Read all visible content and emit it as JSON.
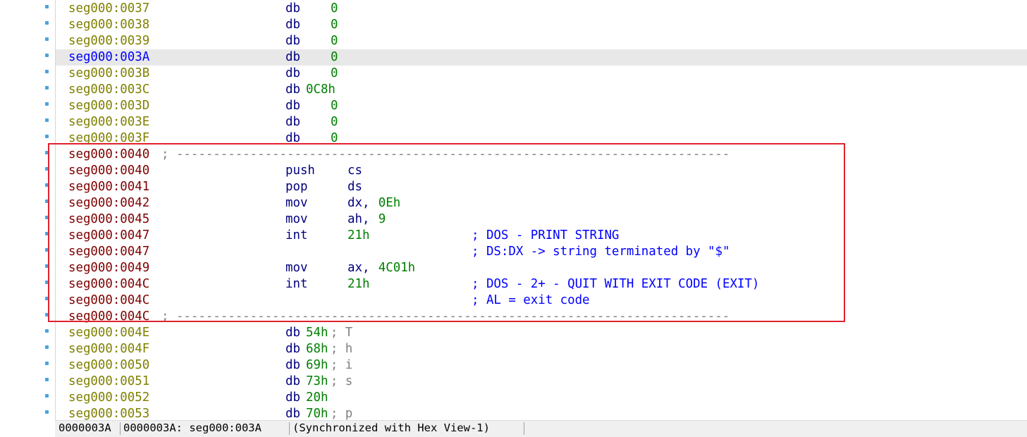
{
  "rows": [
    {
      "addr": "seg000:0037",
      "kind": "data",
      "mn": "db",
      "op": "0"
    },
    {
      "addr": "seg000:0038",
      "kind": "data",
      "mn": "db",
      "op": "0"
    },
    {
      "addr": "seg000:0039",
      "kind": "data",
      "mn": "db",
      "op": "0"
    },
    {
      "addr": "seg000:003A",
      "kind": "data",
      "mn": "db",
      "op": "0",
      "current": true
    },
    {
      "addr": "seg000:003B",
      "kind": "data",
      "mn": "db",
      "op": "0"
    },
    {
      "addr": "seg000:003C",
      "kind": "data",
      "mn": "db",
      "op": "0C8h"
    },
    {
      "addr": "seg000:003D",
      "kind": "data",
      "mn": "db",
      "op": "0"
    },
    {
      "addr": "seg000:003E",
      "kind": "data",
      "mn": "db",
      "op": "0"
    },
    {
      "addr": "seg000:003F",
      "kind": "data",
      "mn": "db",
      "op": "0"
    },
    {
      "addr": "seg000:0040",
      "kind": "code",
      "sep": "; ---------------------------------------------------------------------------"
    },
    {
      "addr": "seg000:0040",
      "kind": "code",
      "mn": "push",
      "reg": "cs"
    },
    {
      "addr": "seg000:0041",
      "kind": "code",
      "mn": "pop",
      "reg": "ds"
    },
    {
      "addr": "seg000:0042",
      "kind": "code",
      "mn": "mov",
      "reg": "dx, ",
      "num": "0Eh"
    },
    {
      "addr": "seg000:0045",
      "kind": "code",
      "mn": "mov",
      "reg": "ah, ",
      "num": "9"
    },
    {
      "addr": "seg000:0047",
      "kind": "code",
      "mn": "int",
      "num": "21h",
      "cmt": "; DOS - PRINT STRING"
    },
    {
      "addr": "seg000:0047",
      "kind": "code",
      "cmt": "; DS:DX -> string terminated by \"$\""
    },
    {
      "addr": "seg000:0049",
      "kind": "code",
      "mn": "mov",
      "reg": "ax, ",
      "num": "4C01h"
    },
    {
      "addr": "seg000:004C",
      "kind": "code",
      "mn": "int",
      "num": "21h",
      "cmt": "; DOS - 2+ - QUIT WITH EXIT CODE (EXIT)"
    },
    {
      "addr": "seg000:004C",
      "kind": "code",
      "cmt": "; AL = exit code"
    },
    {
      "addr": "seg000:004C",
      "kind": "code",
      "sep": "; ---------------------------------------------------------------------------"
    },
    {
      "addr": "seg000:004E",
      "kind": "data",
      "mn": "db",
      "op": "54h",
      "scmt": "; T"
    },
    {
      "addr": "seg000:004F",
      "kind": "data",
      "mn": "db",
      "op": "68h",
      "scmt": "; h"
    },
    {
      "addr": "seg000:0050",
      "kind": "data",
      "mn": "db",
      "op": "69h",
      "scmt": "; i"
    },
    {
      "addr": "seg000:0051",
      "kind": "data",
      "mn": "db",
      "op": "73h",
      "scmt": "; s"
    },
    {
      "addr": "seg000:0052",
      "kind": "data",
      "mn": "db",
      "op": "20h"
    },
    {
      "addr": "seg000:0053",
      "kind": "data",
      "mn": "db",
      "op": "70h",
      "scmt": "; p"
    }
  ],
  "statusbar": {
    "file_offset": "0000003A",
    "location": "0000003A: seg000:003A",
    "sync": "(Synchronized with Hex View-1)"
  },
  "colors": {
    "highlight_border": "#e0232e",
    "data_address": "#808000",
    "code_address": "#800000",
    "current_address": "#0000ff",
    "number": "#008000",
    "comment": "#0000ff"
  },
  "icons": [
    "breakpoint-dot-icon"
  ]
}
